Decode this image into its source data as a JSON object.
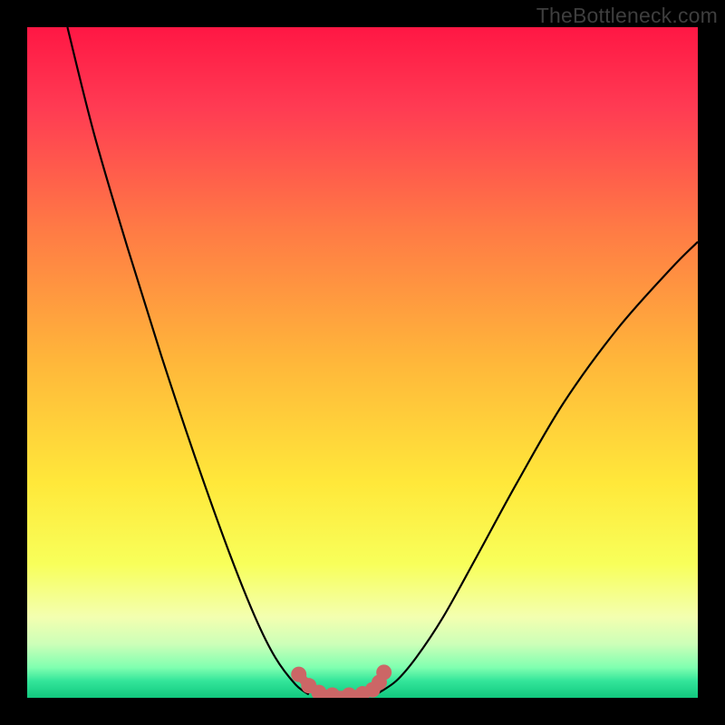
{
  "watermark": "TheBottleneck.com",
  "chart_data": {
    "type": "line",
    "title": "",
    "xlabel": "",
    "ylabel": "",
    "xlim": [
      0,
      100
    ],
    "ylim": [
      0,
      100
    ],
    "grid": false,
    "legend": false,
    "series": [
      {
        "name": "left-branch",
        "x": [
          6,
          10,
          15,
          20,
          25,
          30,
          34,
          37,
          40,
          42
        ],
        "y": [
          100,
          84,
          67,
          51,
          36,
          22,
          12,
          6,
          2,
          0.5
        ]
      },
      {
        "name": "right-branch",
        "x": [
          52,
          55,
          58,
          62,
          67,
          73,
          80,
          88,
          96,
          100
        ],
        "y": [
          0.5,
          2.5,
          6,
          12,
          21,
          32,
          44,
          55,
          64,
          68
        ]
      }
    ],
    "highlight_points": {
      "name": "bottom-markers",
      "color": "#cc6666",
      "points": [
        {
          "x": 40.5,
          "y": 3.5
        },
        {
          "x": 42.0,
          "y": 1.8
        },
        {
          "x": 43.5,
          "y": 0.8
        },
        {
          "x": 45.5,
          "y": 0.4
        },
        {
          "x": 48.0,
          "y": 0.4
        },
        {
          "x": 50.0,
          "y": 0.6
        },
        {
          "x": 51.5,
          "y": 1.2
        },
        {
          "x": 52.5,
          "y": 2.3
        },
        {
          "x": 53.2,
          "y": 3.8
        }
      ]
    },
    "background_gradient": {
      "stops": [
        {
          "offset": 0.0,
          "color": "#ff1744"
        },
        {
          "offset": 0.12,
          "color": "#ff3b53"
        },
        {
          "offset": 0.3,
          "color": "#ff7a45"
        },
        {
          "offset": 0.5,
          "color": "#ffb73a"
        },
        {
          "offset": 0.68,
          "color": "#ffe83a"
        },
        {
          "offset": 0.8,
          "color": "#f8ff5a"
        },
        {
          "offset": 0.88,
          "color": "#f3ffb0"
        },
        {
          "offset": 0.92,
          "color": "#ccffb8"
        },
        {
          "offset": 0.955,
          "color": "#7fffb0"
        },
        {
          "offset": 0.975,
          "color": "#33e59a"
        },
        {
          "offset": 1.0,
          "color": "#11c97f"
        }
      ]
    }
  }
}
